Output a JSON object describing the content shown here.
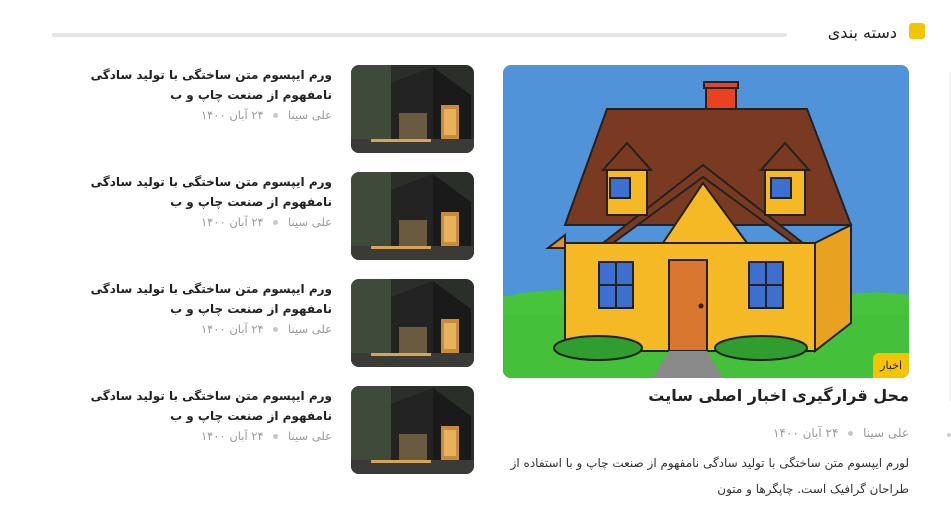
{
  "section": {
    "title": "دسته بندی",
    "accent_color": "#f5c400"
  },
  "featured": {
    "image_icon": "house-illustration",
    "category": "اخبار",
    "title": "محل قرارگیری اخبار اصلی سایت",
    "author": "علی سینا",
    "date": "۲۴ آبان ۱۴۰۰",
    "excerpt": "لورم ایپسوم متن ساختگی با تولید سادگی نامفهوم از صنعت چاپ و با استفاده از طراحان گرافیک است. چاپگرها و متون"
  },
  "posts": [
    {
      "image_icon": "dark-house-photo",
      "title": "ورم ایپسوم متن ساختگی با تولید سادگی نامفهوم از صنعت چاپ و ب",
      "author": "علی سینا",
      "date": "۲۴ آبان ۱۴۰۰"
    },
    {
      "image_icon": "dark-house-photo",
      "title": "ورم ایپسوم متن ساختگی با تولید سادگی نامفهوم از صنعت چاپ و ب",
      "author": "علی سینا",
      "date": "۲۴ آبان ۱۴۰۰"
    },
    {
      "image_icon": "dark-house-photo",
      "title": "ورم ایپسوم متن ساختگی با تولید سادگی نامفهوم از صنعت چاپ و ب",
      "author": "علی سینا",
      "date": "۲۴ آبان ۱۴۰۰"
    },
    {
      "image_icon": "dark-house-photo",
      "title": "ورم ایپسوم متن ساختگی با تولید سادگی نامفهوم از صنعت چاپ و ب",
      "author": "علی سینا",
      "date": "۲۴ آبان ۱۴۰۰"
    }
  ]
}
